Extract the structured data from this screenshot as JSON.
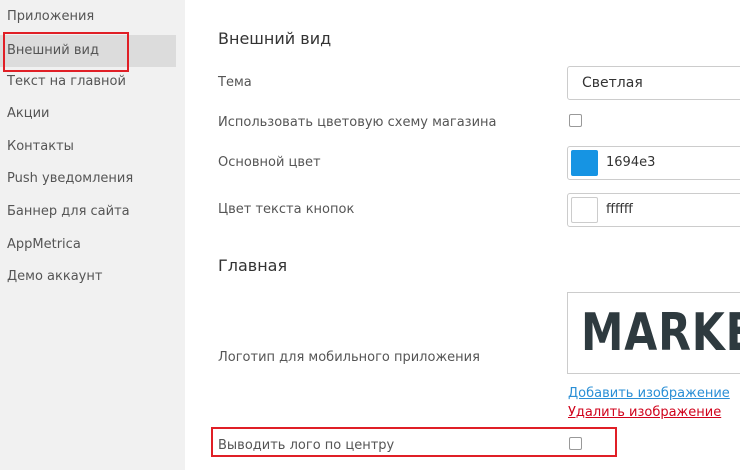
{
  "sidebar": {
    "items": [
      {
        "label": "Приложения"
      },
      {
        "label": "Внешний вид"
      },
      {
        "label": "Текст на главной"
      },
      {
        "label": "Акции"
      },
      {
        "label": "Контакты"
      },
      {
        "label": "Push уведомления"
      },
      {
        "label": "Баннер для сайта"
      },
      {
        "label": "AppMetrica"
      },
      {
        "label": "Демо аккаунт"
      }
    ],
    "active_index": 1
  },
  "main": {
    "appearance_title": "Внешний вид",
    "theme_label": "Тема",
    "theme_value": "Светлая",
    "use_store_colors_label": "Использовать цветовую схему магазина",
    "use_store_colors_checked": false,
    "primary_color_label": "Основной цвет",
    "primary_color_value": "1694e3",
    "primary_color_hex": "#1694e3",
    "button_text_color_label": "Цвет текста кнопок",
    "button_text_color_value": "ffffff",
    "button_text_color_hex": "#ffffff",
    "home_title": "Главная",
    "logo_label": "Логотип для мобильного приложения",
    "logo_text": "MARKET",
    "add_image_link": "Добавить изображение",
    "delete_image_link": "Удалить изображение",
    "center_logo_label": "Выводить лого по центру",
    "center_logo_checked": false
  },
  "colors": {
    "link_blue": "#2a8fd6",
    "link_red": "#d0021b",
    "highlight_red": "#e01f26"
  }
}
